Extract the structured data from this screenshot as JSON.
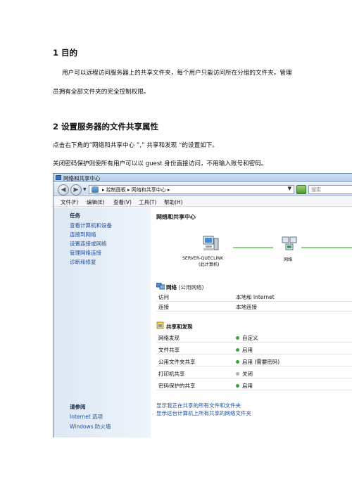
{
  "doc": {
    "s1_heading": "1  目的",
    "s1_p1": "用户可以远程访问服务器上的共享文件夹，每个用户只能访问所在分组的文件夹。管理",
    "s1_p2": "员拥有全部文件夹的完全控制权限。",
    "s2_heading": "2  设置服务器的文件共享属性",
    "s2_p1": "点击右下角的”网络和共享中心 ”,” 共享和发现 “的设置如下。",
    "s2_p2": "关闭密码保护则使所有用户可以以 guest 身份直接访问，不用输入账号和密码。"
  },
  "window": {
    "title": "网络和共享中心",
    "address_path": "▸ 控制面板 ▸ 网络和共享中心 ▸",
    "search_placeholder": "搜索",
    "menu": [
      "文件(F)",
      "编辑(E)",
      "查看(V)",
      "工具(T)",
      "帮助(H)"
    ],
    "sidebar": {
      "tasks_heading": "任务",
      "tasks": [
        "查看计算机和设备",
        "连接到网络",
        "设置连接或网络",
        "管理网络连接",
        "诊断和修复"
      ],
      "see_also_heading": "请参阅",
      "see_also": [
        "Internet 选项",
        "Windows 防火墙"
      ]
    },
    "main": {
      "title": "网络和共享中心",
      "computer_name": "SERVER-QUECLINK",
      "computer_sub": "(此计算机)",
      "network_node": "网络",
      "network_heading": "网络",
      "network_sub": "(公用网络)",
      "network_rows": [
        {
          "key": "访问",
          "value": "本地和 Internet"
        },
        {
          "key": "连接",
          "value": "本地连接"
        }
      ],
      "sharing_heading": "共享和发现",
      "sharing_rows": [
        {
          "key": "网络发现",
          "value": "自定义",
          "status": "on"
        },
        {
          "key": "文件共享",
          "value": "启用",
          "status": "on"
        },
        {
          "key": "公用文件夹共享",
          "value": "启用 (需要密码)",
          "status": "on"
        },
        {
          "key": "打印机共享",
          "value": "关闭",
          "status": "off"
        },
        {
          "key": "密码保护的共享",
          "value": "启用",
          "status": "on"
        }
      ],
      "links": [
        "显示我正在共享的所有文件和文件夹",
        "显示这台计算机上所有共享的网络文件夹"
      ]
    }
  },
  "colors": {
    "link": "#1f4f9a",
    "on": "#3ea33a",
    "off": "#aab3bc",
    "line": "#8bd27e"
  }
}
